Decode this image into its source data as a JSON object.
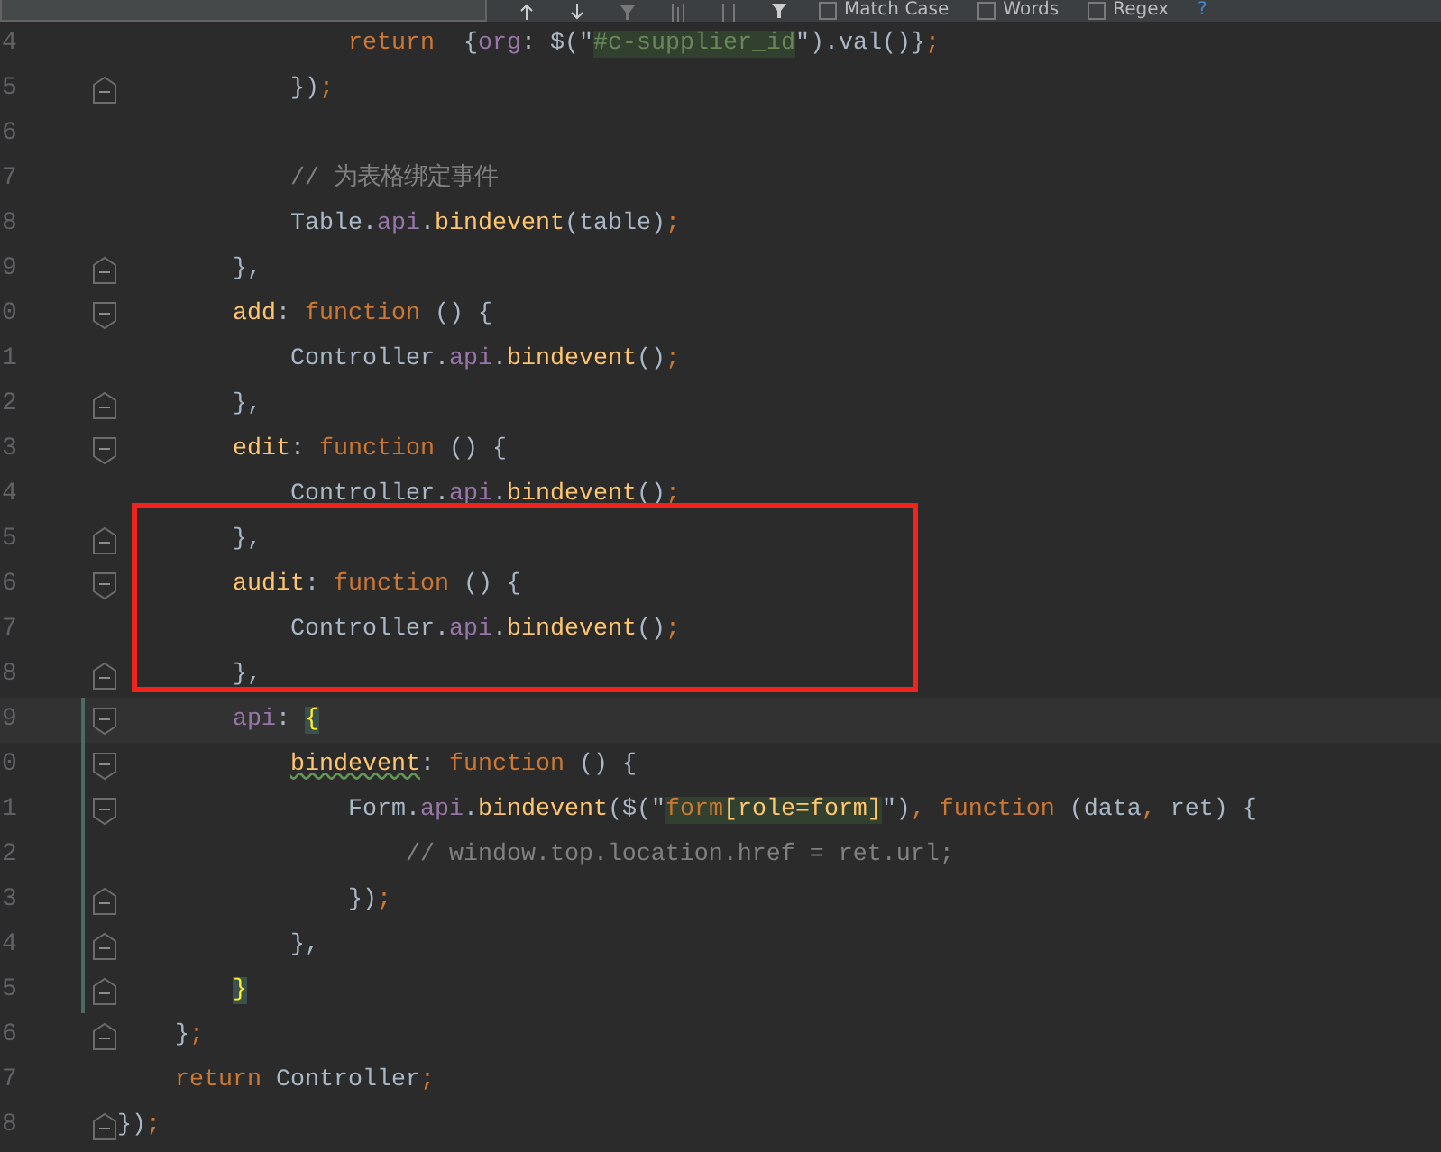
{
  "find_bar": {
    "options": [
      {
        "label": "Match Case",
        "checked": false
      },
      {
        "label": "Words",
        "checked": false
      },
      {
        "label": "Regex",
        "checked": false
      }
    ],
    "help": "?"
  },
  "lines": [
    {
      "number": "4",
      "fold_start": false,
      "fold_end": false,
      "tokens": [
        {
          "kind": "keyword",
          "text": "                return"
        },
        {
          "kind": "plain",
          "text": "  {"
        },
        {
          "kind": "property",
          "text": "org"
        },
        {
          "kind": "plain",
          "text": ": $(\""
        },
        {
          "kind": "string",
          "text": "#c-supplier_id",
          "match": true
        },
        {
          "kind": "plain",
          "text": "\").val()}"
        },
        {
          "kind": "keyword",
          "text": ";"
        }
      ]
    },
    {
      "number": "5",
      "fold_start": false,
      "fold_end": true,
      "tokens": [
        {
          "kind": "plain",
          "text": "            })"
        },
        {
          "kind": "keyword",
          "text": ";"
        }
      ]
    },
    {
      "number": "6",
      "fold_start": false,
      "fold_end": false
    },
    {
      "number": "7",
      "fold_start": false,
      "fold_end": false,
      "tokens": [
        {
          "kind": "comment",
          "text": "            // 为表格绑定事件"
        }
      ]
    },
    {
      "number": "8",
      "fold_start": false,
      "fold_end": false,
      "tokens": [
        {
          "kind": "plain",
          "text": "            Table."
        },
        {
          "kind": "property",
          "text": "api"
        },
        {
          "kind": "plain",
          "text": "."
        },
        {
          "kind": "function",
          "text": "bindevent"
        },
        {
          "kind": "plain",
          "text": "(table)"
        },
        {
          "kind": "keyword",
          "text": ";"
        }
      ]
    },
    {
      "number": "9",
      "fold_start": false,
      "fold_end": true,
      "tokens": [
        {
          "kind": "plain",
          "text": "        },"
        }
      ]
    },
    {
      "number": "0",
      "fold_start": true,
      "fold_end": false,
      "tokens": [
        {
          "kind": "function",
          "text": "        add"
        },
        {
          "kind": "plain",
          "text": ": "
        },
        {
          "kind": "keyword",
          "text": "function"
        },
        {
          "kind": "plain",
          "text": " () {"
        }
      ]
    },
    {
      "number": "1",
      "fold_start": false,
      "fold_end": false,
      "tokens": [
        {
          "kind": "plain",
          "text": "            Controller."
        },
        {
          "kind": "property",
          "text": "api"
        },
        {
          "kind": "plain",
          "text": "."
        },
        {
          "kind": "function",
          "text": "bindevent"
        },
        {
          "kind": "plain",
          "text": "()"
        },
        {
          "kind": "keyword",
          "text": ";"
        }
      ]
    },
    {
      "number": "2",
      "fold_start": false,
      "fold_end": true,
      "tokens": [
        {
          "kind": "plain",
          "text": "        },"
        }
      ]
    },
    {
      "number": "3",
      "fold_start": true,
      "fold_end": false,
      "tokens": [
        {
          "kind": "function",
          "text": "        edit"
        },
        {
          "kind": "plain",
          "text": ": "
        },
        {
          "kind": "keyword",
          "text": "function"
        },
        {
          "kind": "plain",
          "text": " () {"
        }
      ]
    },
    {
      "number": "4",
      "fold_start": false,
      "fold_end": false,
      "tokens": [
        {
          "kind": "plain",
          "text": "            Controller."
        },
        {
          "kind": "property",
          "text": "api"
        },
        {
          "kind": "plain",
          "text": "."
        },
        {
          "kind": "function",
          "text": "bindevent"
        },
        {
          "kind": "plain",
          "text": "()"
        },
        {
          "kind": "keyword",
          "text": ";"
        }
      ]
    },
    {
      "number": "5",
      "fold_start": false,
      "fold_end": true,
      "boxed": true,
      "tokens": [
        {
          "kind": "plain",
          "text": "        },"
        }
      ]
    },
    {
      "number": "6",
      "fold_start": true,
      "fold_end": false,
      "boxed": true,
      "tokens": [
        {
          "kind": "function",
          "text": "        audit"
        },
        {
          "kind": "plain",
          "text": ": "
        },
        {
          "kind": "keyword",
          "text": "function"
        },
        {
          "kind": "plain",
          "text": " () {"
        }
      ]
    },
    {
      "number": "7",
      "fold_start": false,
      "fold_end": false,
      "boxed": true,
      "tokens": [
        {
          "kind": "plain",
          "text": "            Controller."
        },
        {
          "kind": "property",
          "text": "api"
        },
        {
          "kind": "plain",
          "text": "."
        },
        {
          "kind": "function",
          "text": "bindevent"
        },
        {
          "kind": "plain",
          "text": "()"
        },
        {
          "kind": "keyword",
          "text": ";"
        }
      ]
    },
    {
      "number": "8",
      "fold_start": false,
      "fold_end": true,
      "boxed": true,
      "tokens": [
        {
          "kind": "plain",
          "text": "        },"
        }
      ]
    },
    {
      "number": "9",
      "fold_start": true,
      "fold_end": false,
      "current": true,
      "changed": true,
      "tokens": [
        {
          "kind": "property",
          "text": "        api"
        },
        {
          "kind": "plain",
          "text": ": "
        },
        {
          "kind": "bracket",
          "text": "{"
        }
      ]
    },
    {
      "number": "0",
      "fold_start": true,
      "fold_end": false,
      "changed": true,
      "tokens": [
        {
          "kind": "function",
          "text": "            bindevent",
          "warn": true
        },
        {
          "kind": "plain",
          "text": ": "
        },
        {
          "kind": "keyword",
          "text": "function"
        },
        {
          "kind": "plain",
          "text": " () {"
        }
      ]
    },
    {
      "number": "1",
      "fold_start": true,
      "fold_end": false,
      "changed": true,
      "tokens": [
        {
          "kind": "plain",
          "text": "                Form."
        },
        {
          "kind": "property",
          "text": "api"
        },
        {
          "kind": "plain",
          "text": "."
        },
        {
          "kind": "function",
          "text": "bindevent"
        },
        {
          "kind": "plain",
          "text": "($(\""
        },
        {
          "kind": "keyword",
          "text": "form",
          "match": true
        },
        {
          "kind": "function",
          "text": "[role=form]",
          "match": true
        },
        {
          "kind": "plain",
          "text": "\")"
        },
        {
          "kind": "keyword",
          "text": ", function"
        },
        {
          "kind": "plain",
          "text": " (data"
        },
        {
          "kind": "keyword",
          "text": ","
        },
        {
          "kind": "plain",
          "text": " ret) {"
        }
      ]
    },
    {
      "number": "2",
      "fold_start": false,
      "fold_end": false,
      "changed": true,
      "tokens": [
        {
          "kind": "comment",
          "text": "                    // window.top.location.href = ret.url;"
        }
      ]
    },
    {
      "number": "3",
      "fold_start": false,
      "fold_end": true,
      "changed": true,
      "tokens": [
        {
          "kind": "plain",
          "text": "                })"
        },
        {
          "kind": "keyword",
          "text": ";"
        }
      ]
    },
    {
      "number": "4",
      "fold_start": false,
      "fold_end": true,
      "changed": true,
      "tokens": [
        {
          "kind": "plain",
          "text": "            },"
        }
      ]
    },
    {
      "number": "5",
      "fold_start": false,
      "fold_end": true,
      "changed": true,
      "tokens": [
        {
          "kind": "bracket",
          "text": "        }"
        }
      ]
    },
    {
      "number": "6",
      "fold_start": false,
      "fold_end": true,
      "tokens": [
        {
          "kind": "plain",
          "text": "    }"
        },
        {
          "kind": "keyword",
          "text": ";"
        }
      ]
    },
    {
      "number": "7",
      "fold_start": false,
      "fold_end": false,
      "tokens": [
        {
          "kind": "keyword",
          "text": "    return"
        },
        {
          "kind": "plain",
          "text": " Controller"
        },
        {
          "kind": "keyword",
          "text": ";"
        }
      ]
    },
    {
      "number": "8",
      "fold_start": false,
      "fold_end": true,
      "tokens": [
        {
          "kind": "plain",
          "text": "})"
        },
        {
          "kind": "keyword",
          "text": ";"
        }
      ]
    }
  ]
}
